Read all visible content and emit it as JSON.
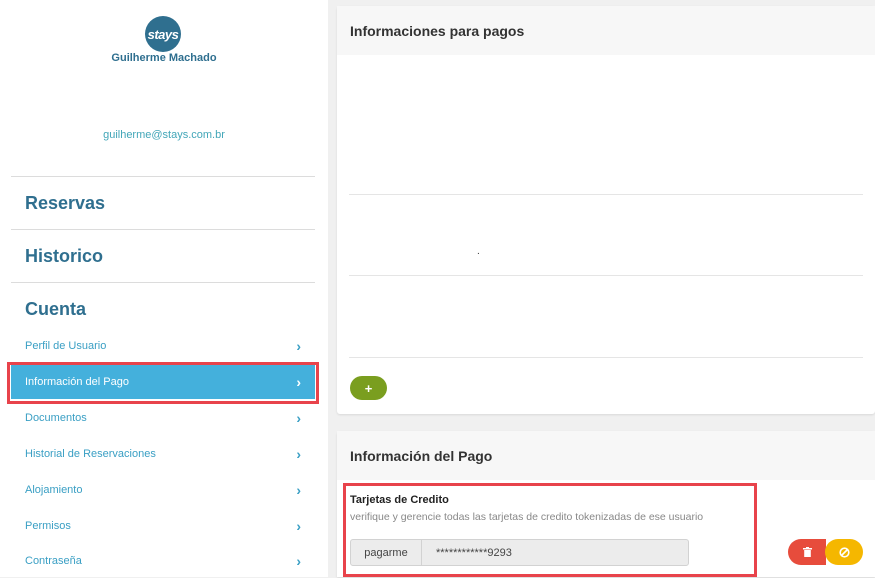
{
  "sidebar": {
    "logo_text": "stays",
    "user_name": "Guilherme Machado",
    "user_email": "guilherme@stays.com.br",
    "sections": [
      "Reservas",
      "Historico",
      "Cuenta"
    ],
    "menu": [
      {
        "label": "Perfil de Usuario"
      },
      {
        "label": "Información del Pago"
      },
      {
        "label": "Documentos"
      },
      {
        "label": "Historial de Reservaciones"
      },
      {
        "label": "Alojamiento"
      },
      {
        "label": "Permisos"
      },
      {
        "label": "Contraseña"
      }
    ],
    "active_index": 1
  },
  "payments_panel": {
    "title": "Informaciones para pagos",
    "dot": ".",
    "add_label": "+"
  },
  "payment_info": {
    "title": "Información del Pago",
    "card_title": "Tarjetas de Credito",
    "card_subtitle": "verifique y gerencie todas las tarjetas de credito tokenizadas de ese usuario",
    "provider": "pagarme",
    "card_number": "************9293"
  },
  "icons": {
    "chevron": "chevron-right-icon",
    "delete": "trash-icon",
    "cancel": "ban-icon"
  },
  "colors": {
    "brand": "#2f6f8f",
    "active_item": "#44b0dc",
    "highlight": "#e8434b",
    "add_button": "#7a9e1f",
    "delete_button": "#e74c3c",
    "cancel_button": "#f5b700"
  }
}
